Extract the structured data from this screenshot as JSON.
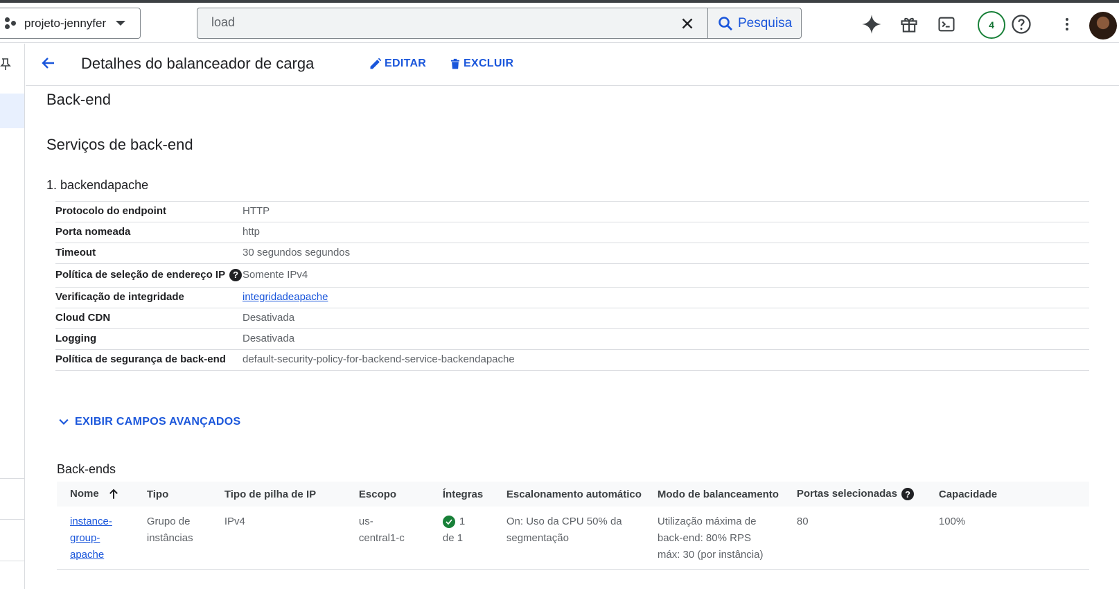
{
  "topbar": {
    "project_name": "projeto-jennyfer",
    "search_value": "load",
    "search_button_label": "Pesquisa",
    "notifications_count": "4"
  },
  "header": {
    "title": "Detalhes do balanceador de carga",
    "edit_label": "EDITAR",
    "delete_label": "EXCLUIR"
  },
  "main": {
    "section_title": "Back-end",
    "subsection_title": "Serviços de back-end",
    "service_title": "1. backendapache",
    "properties": [
      {
        "key": "Protocolo do endpoint",
        "value": "HTTP"
      },
      {
        "key": "Porta nomeada",
        "value": "http"
      },
      {
        "key": "Timeout",
        "value": "30 segundos segundos"
      },
      {
        "key": "Política de seleção de endereço IP",
        "value": "Somente IPv4"
      },
      {
        "key": "Verificação de integridade",
        "value": "integridadeapache"
      },
      {
        "key": "Cloud CDN",
        "value": "Desativada"
      },
      {
        "key": "Logging",
        "value": "Desativada"
      },
      {
        "key": "Política de segurança de back-end",
        "value": "default-security-policy-for-backend-service-backendapache"
      }
    ],
    "advanced_label": "EXIBIR CAMPOS AVANÇADOS",
    "backends_title": "Back-ends",
    "table": {
      "headers": [
        "Nome",
        "Tipo",
        "Tipo de pilha de IP",
        "Escopo",
        "Íntegras",
        "Escalonamento automático",
        "Modo de balanceamento",
        "Portas selecionadas",
        "Capacidade"
      ],
      "rows": [
        {
          "name": "instance-group-apache",
          "type": "Grupo de instâncias",
          "ip_stack": "IPv4",
          "scope": "us-central1-c",
          "healthy": "1 de 1",
          "autoscaling": "On: Uso da CPU 50% da segmentação",
          "balancing_mode": "Utilização máxima de back-end: 80% RPS máx: 30 (por instância)",
          "ports": "80",
          "capacity": "100%"
        }
      ]
    }
  },
  "colors": {
    "link": "#1a56db",
    "healthy": "#188038",
    "text": "#202124",
    "muted": "#5f6368"
  }
}
